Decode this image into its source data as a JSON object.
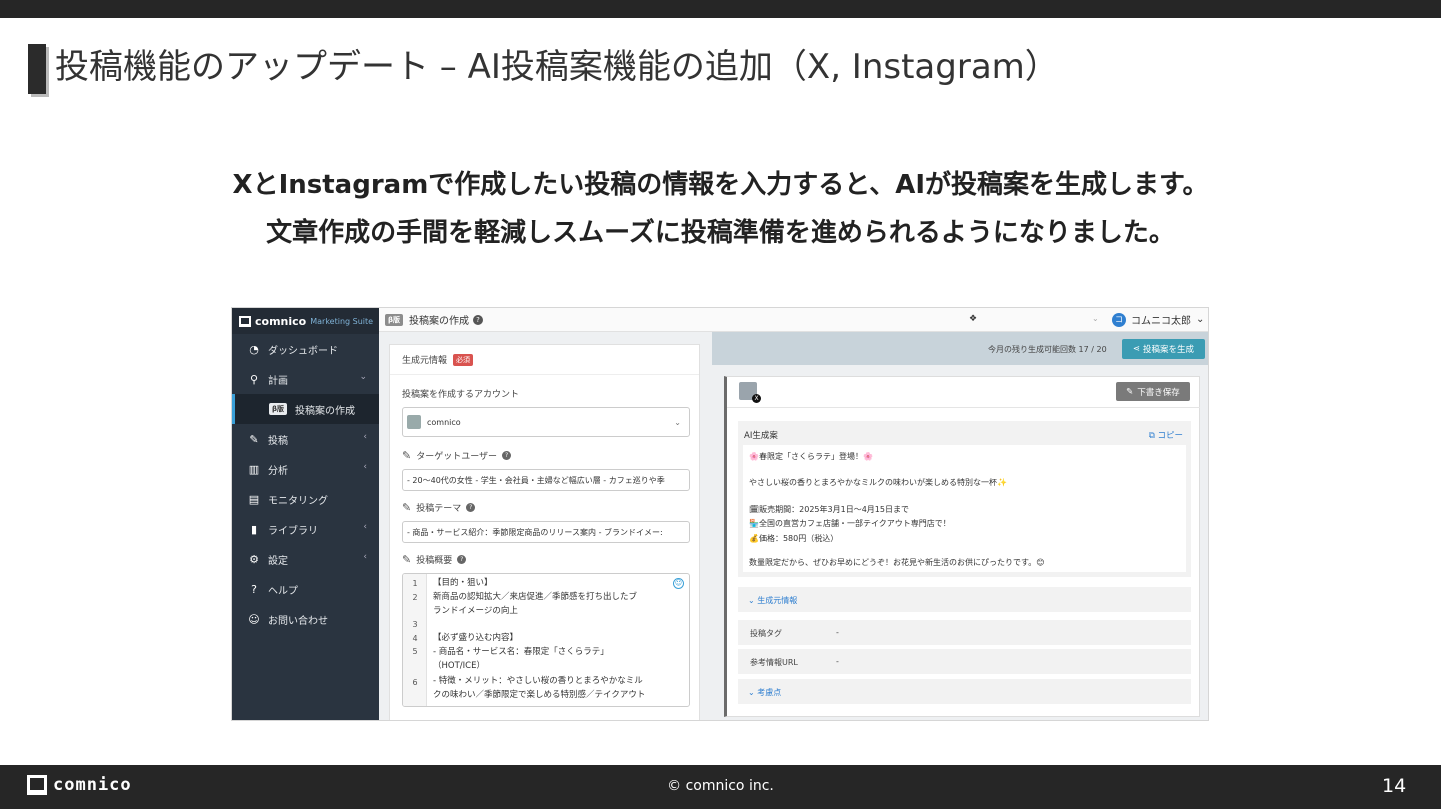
{
  "slide": {
    "title": "投稿機能のアップデート – AI投稿案機能の追加（X, Instagram）",
    "lead_line1": "XとInstagramで作成したい投稿の情報を入力すると、AIが投稿案を生成します。",
    "lead_line2": "文章作成の手間を軽減しスムーズに投稿準備を進められるようになりました。"
  },
  "app": {
    "brand": "comnico",
    "suite": "Marketing Suite",
    "header_beta": "β版",
    "page_title": "投稿案の作成",
    "user_initial": "コ",
    "user_name": "コムニコ太郎"
  },
  "sidebar": {
    "items": [
      {
        "label": "ダッシュボード",
        "icon": "dashboard-icon",
        "glyph": "◔"
      },
      {
        "label": "計画",
        "icon": "compass-icon",
        "glyph": "⚲"
      },
      {
        "label": "投稿案の作成",
        "beta": "β版"
      },
      {
        "label": "投稿",
        "icon": "pencil-icon",
        "glyph": "✎"
      },
      {
        "label": "分析",
        "icon": "bar-chart-icon",
        "glyph": "▥"
      },
      {
        "label": "モニタリング",
        "icon": "chat-icon",
        "glyph": "▤"
      },
      {
        "label": "ライブラリ",
        "icon": "book-icon",
        "glyph": "▮"
      },
      {
        "label": "設定",
        "icon": "gear-icon",
        "glyph": "⚙"
      },
      {
        "label": "ヘルプ",
        "icon": "help-icon",
        "glyph": "?"
      },
      {
        "label": "お問い合わせ",
        "icon": "support-icon",
        "glyph": "☺"
      }
    ]
  },
  "form": {
    "section_title": "生成元情報",
    "required_badge": "必須",
    "account_label": "投稿案を作成するアカウント",
    "account_value": "comnico",
    "target_label": "ターゲットユーザー",
    "target_value": "- 20〜40代の女性 - 学生・会社員・主婦など幅広い層 - カフェ巡りや季",
    "theme_label": "投稿テーマ",
    "theme_value": "- 商品・サービス紹介：季節限定商品のリリース案内 - ブランドイメー:",
    "summary_label": "投稿概要",
    "editor_line_numbers": [
      "1",
      "2",
      "3",
      "4",
      "5",
      "6"
    ],
    "editor_lines": [
      "【目的・狙い】",
      "新商品の認知拡大／来店促進／季節感を打ち出したブ",
      "ランドイメージの向上",
      "",
      "【必ず盛り込む内容】",
      "- 商品名・サービス名：春限定「さくらラテ」",
      "（HOT/ICE）",
      "- 特徴・メリット：やさしい桜の香りとまろやかなミル",
      "クの味わい／季節限定で楽しめる特別感／テイクアウト"
    ]
  },
  "result": {
    "remaining_label": "今月の残り生成可能回数",
    "remaining_value": "17 / 20",
    "generate_button": "投稿案を生成",
    "draft_button": "下書き保存",
    "ai_title": "AI生成案",
    "copy_label": "コピー",
    "lines": [
      "🌸春限定「さくらラテ」登場！🌸",
      "やさしい桜の香りとまろやかなミルクの味わいが楽しめる特別な一杯✨",
      "🗓販売期間：2025年3月1日〜4月15日まで",
      "🏪全国の直営カフェ店舗・一部テイクアウト専門店で！",
      "💰価格：580円（税込）",
      "数量限定だから、ぜひお早めにどうぞ！お花見や新生活のお供にぴったりです。😊"
    ],
    "source_info_toggle": "生成元情報",
    "tag_label": "投稿タグ",
    "tag_value": "-",
    "url_label": "参考情報URL",
    "url_value": "-",
    "notes_toggle": "考慮点"
  },
  "footer": {
    "logo": "comnico",
    "copyright": "© comnico inc.",
    "page_number": "14"
  }
}
